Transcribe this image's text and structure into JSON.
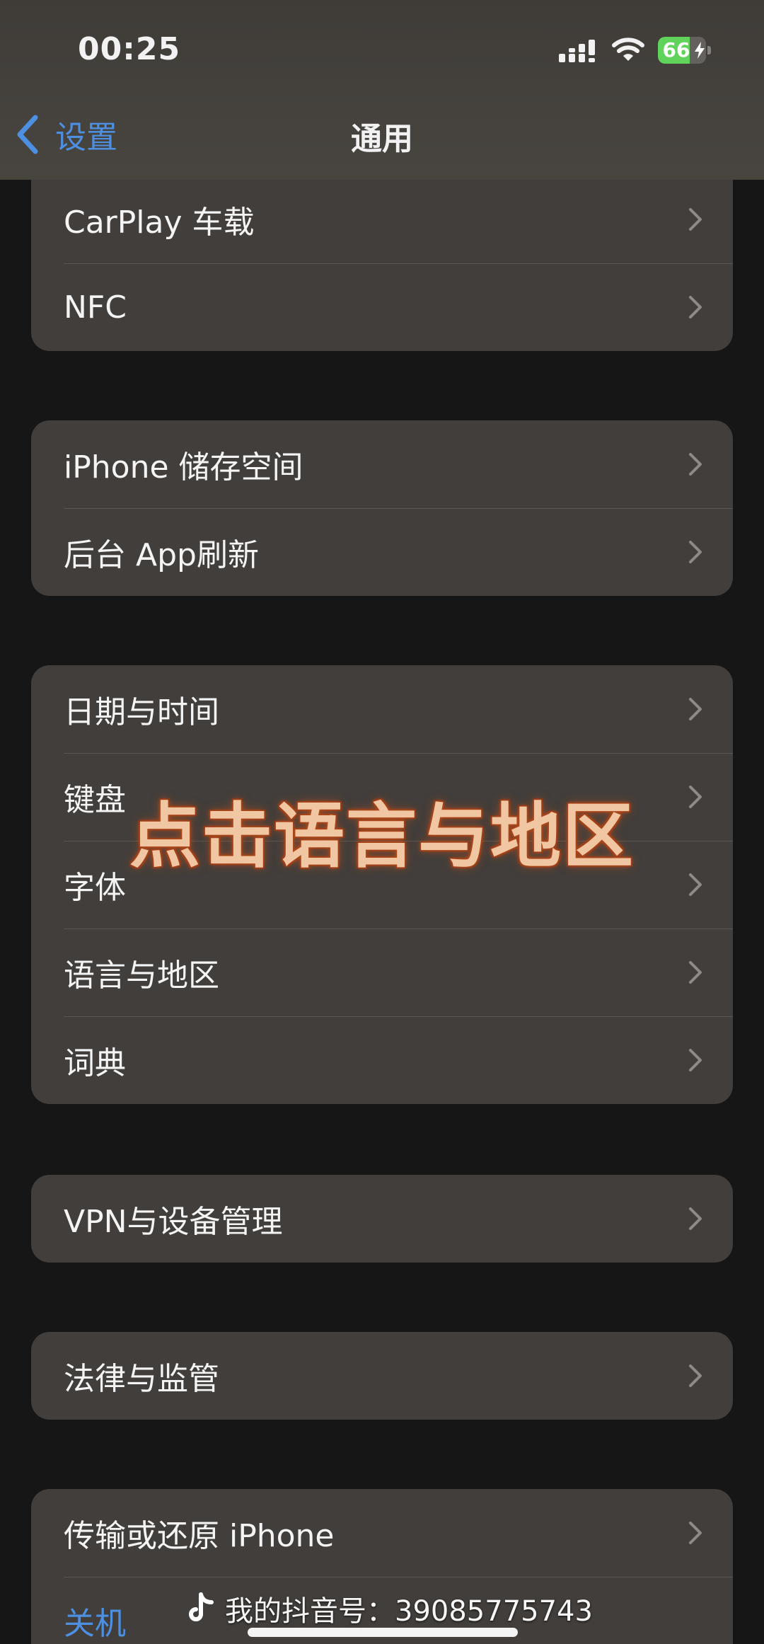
{
  "status_bar": {
    "time": "00:25",
    "battery_text": "66",
    "battery_level_fraction": 0.66,
    "signal_icon": "cellular-signal-icon",
    "wifi_icon": "wifi-icon",
    "battery_icon": "battery-charging-icon"
  },
  "nav": {
    "back_label": "设置",
    "title": "通用"
  },
  "groups": {
    "connectivity": [
      "CarPlay 车载",
      "NFC"
    ],
    "storage": [
      "iPhone 储存空间",
      "后台 App刷新"
    ],
    "locale": [
      "日期与时间",
      "键盘",
      "字体",
      "语言与地区",
      "词典"
    ],
    "vpn": [
      "VPN与设备管理"
    ],
    "legal": [
      "法律与监管"
    ],
    "reset": [
      "传输或还原 iPhone",
      "关机"
    ]
  },
  "overlay": {
    "caption": "点击语言与地区",
    "watermark": "我的抖音号：39085775743"
  },
  "colors": {
    "background": "#161616",
    "cell": "#423e3b",
    "accent_blue": "#4d8fe0",
    "battery_green": "#5fd35a",
    "caption_fill": "#f0c7a2",
    "caption_glow": "#b24d20"
  }
}
